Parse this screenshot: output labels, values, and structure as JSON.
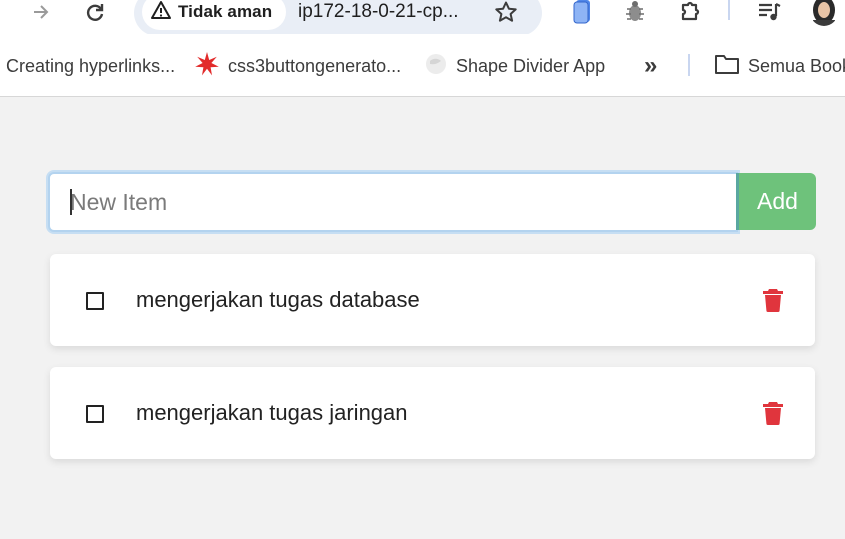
{
  "browser": {
    "security_label": "Tidak aman",
    "url": "ip172-18-0-21-cp...",
    "bookmarks": [
      {
        "label": "Creating hyperlinks...",
        "icon": "none"
      },
      {
        "label": "css3buttongenerato...",
        "icon": "red-star-icon"
      },
      {
        "label": "Shape Divider App",
        "icon": "globe-icon"
      }
    ],
    "more_bookmarks": "»",
    "folder_label": "Semua Book"
  },
  "todo": {
    "input_placeholder": "New Item",
    "add_label": "Add",
    "items": [
      {
        "text": "mengerjakan tugas database",
        "done": false
      },
      {
        "text": "mengerjakan tugas jaringan",
        "done": false
      }
    ]
  },
  "colors": {
    "add_button": "#6ec27b",
    "delete_icon": "#e0353d",
    "page_background": "#f2f2f2"
  }
}
